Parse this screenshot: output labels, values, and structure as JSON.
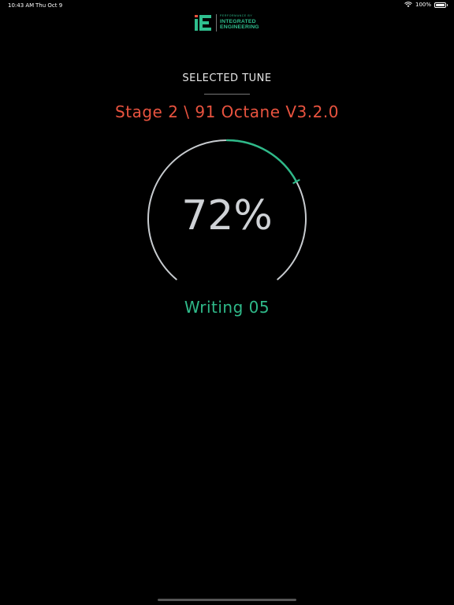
{
  "status_bar": {
    "time": "10:43 AM",
    "date": "Thu Oct 9",
    "battery": "100%"
  },
  "logo": {
    "mark": "iE",
    "small_text": "PERFORMANCE BY",
    "line1": "INTEGRATED",
    "line2": "ENGINEERING"
  },
  "screen": {
    "selected_label": "SELECTED TUNE",
    "tune_name": "Stage 2 \\ 91 Octane V3.2.0",
    "progress_percent": 72,
    "progress_text": "72%",
    "status_text": "Writing 05"
  },
  "colors": {
    "background": "#000000",
    "accent_green": "#2fb989",
    "tune_red": "#e8533f",
    "gauge_track": "#c8ccd0"
  }
}
